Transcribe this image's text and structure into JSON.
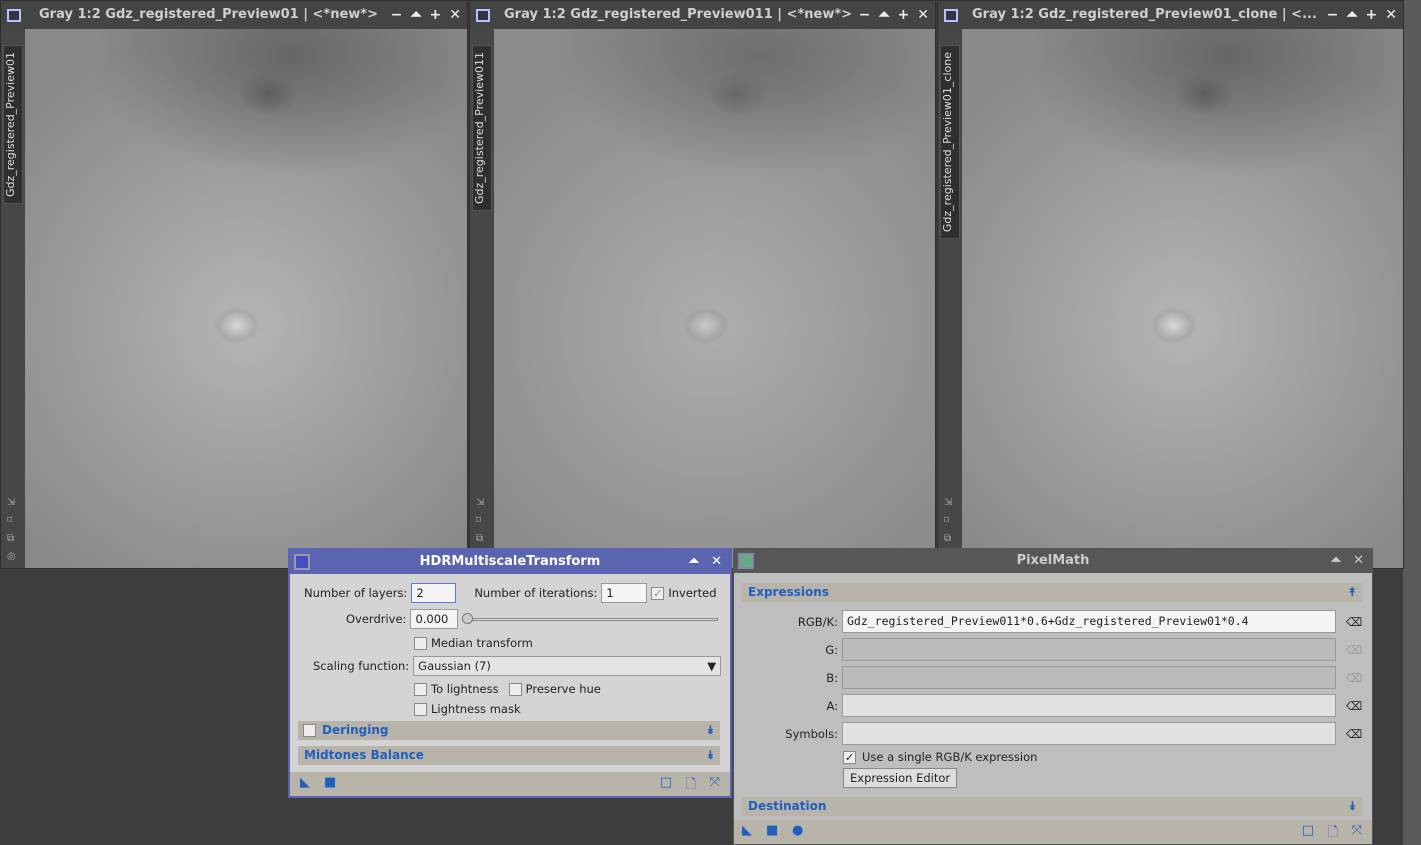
{
  "windows": [
    {
      "title": "Gray 1:2 Gdz_registered_Preview01 | <*new*>",
      "tab": "Gdz_registered_Preview01"
    },
    {
      "title": "Gray 1:2 Gdz_registered_Preview011 | <*new*>",
      "tab": "Gdz_registered_Preview011"
    },
    {
      "title": "Gray 1:2 Gdz_registered_Preview01_clone | <...",
      "tab": "Gdz_registered_Preview01_clone"
    }
  ],
  "window_controls": {
    "minimize": "−",
    "shade": "⏶",
    "maximize": "+",
    "close": "✕"
  },
  "hdr": {
    "title": "HDRMultiscaleTransform",
    "layers_label": "Number of layers:",
    "layers": "2",
    "iterations_label": "Number of iterations:",
    "iterations": "1",
    "inverted_label": "Inverted",
    "inverted": true,
    "overdrive_label": "Overdrive:",
    "overdrive": "0.000",
    "overdrive_slider": 0,
    "median_label": "Median transform",
    "scaling_label": "Scaling function:",
    "scaling": "Gaussian (7)",
    "to_lightness_label": "To lightness",
    "preserve_hue_label": "Preserve hue",
    "lightness_mask_label": "Lightness mask",
    "deringing_label": "Deringing",
    "midtones_label": "Midtones Balance"
  },
  "pixelmath": {
    "title": "PixelMath",
    "expressions_label": "Expressions",
    "rgbk_label": "RGB/K:",
    "rgbk": "Gdz_registered_Preview011*0.6+Gdz_registered_Preview01*0.4",
    "g_label": "G:",
    "b_label": "B:",
    "a_label": "A:",
    "symbols_label": "Symbols:",
    "single_label": "Use a single RGB/K expression",
    "single": true,
    "editor_button": "Expression Editor",
    "destination_label": "Destination"
  },
  "colors": {
    "accent": "#5a64b0",
    "section_text": "#1f5fbf"
  }
}
